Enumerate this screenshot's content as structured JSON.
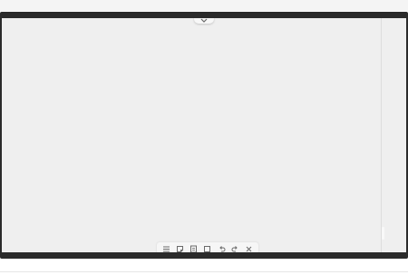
{
  "colors": {
    "bezel": "#2b2b2b",
    "canvas": "#efefef",
    "toolbar_bg": "#f6f6f6",
    "icon": "#6a6a6a"
  },
  "top_pull_tab": {
    "icon": "chevron-down-icon"
  },
  "toolbar": {
    "tools": [
      {
        "icon": "menu-icon"
      },
      {
        "icon": "note-icon"
      },
      {
        "icon": "document-icon"
      },
      {
        "icon": "square-icon"
      },
      {
        "icon": "undo-icon"
      },
      {
        "icon": "redo-icon"
      },
      {
        "icon": "close-icon"
      }
    ]
  }
}
